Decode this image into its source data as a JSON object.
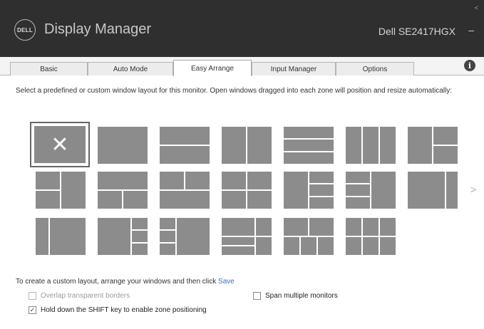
{
  "app": {
    "logo_text": "DELL",
    "title": "Display Manager",
    "monitor": "Dell SE2417HGX",
    "monitor_caret": "–",
    "window_glyph": "<"
  },
  "tabs": [
    {
      "label": "Basic",
      "active": false
    },
    {
      "label": "Auto Mode",
      "active": false
    },
    {
      "label": "Easy Arrange",
      "active": true
    },
    {
      "label": "Input Manager",
      "active": false
    },
    {
      "label": "Options",
      "active": false
    }
  ],
  "info_icon": "i",
  "easy_arrange": {
    "instructions": "Select a predefined or custom window layout for this monitor. Open windows dragged into each zone will position and resize automatically:",
    "selected_layout_glyph": "✕",
    "more_arrow": ">",
    "custom_prefix": "To create a custom layout, arrange your windows and then click ",
    "save_link": "Save",
    "options": {
      "overlap": {
        "label": "Overlap transparent borders",
        "checked": false,
        "enabled": false
      },
      "span": {
        "label": "Span multiple monitors",
        "checked": false,
        "enabled": true
      },
      "shift": {
        "label": "Hold down the SHIFT key to enable zone positioning",
        "checked": true,
        "enabled": true
      }
    }
  },
  "colors": {
    "title_bar": "#2f2f2f",
    "tile": "#8c8c8c",
    "link": "#3a6fc0"
  }
}
